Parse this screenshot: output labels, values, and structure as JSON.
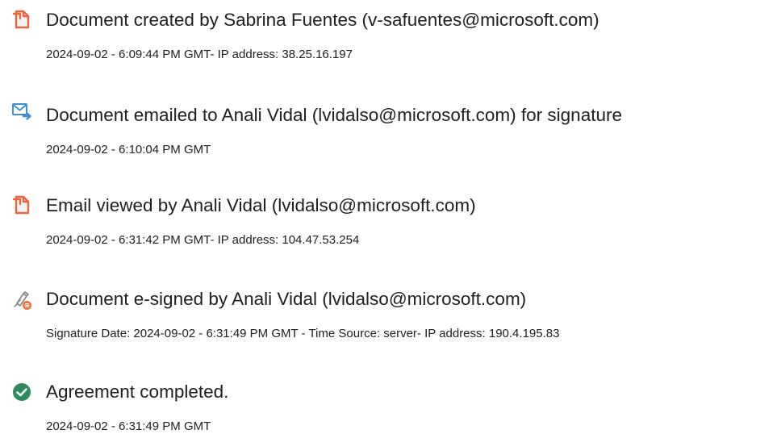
{
  "colors": {
    "document_icon": "#f0643c",
    "email_icon": "#3d8fd6",
    "esign_icon": "#8a8a8a",
    "esign_badge": "#f07138",
    "completed_icon": "#2d8a5b",
    "text": "#202020"
  },
  "events": [
    {
      "icon": "document-icon",
      "title": "Document created by Sabrina Fuentes (v-safuentes@microsoft.com)",
      "detail": "2024-09-02 - 6:09:44 PM GMT- IP address: 38.25.16.197"
    },
    {
      "icon": "email-sent-icon",
      "title": "Document emailed to Anali Vidal (lvidalso@microsoft.com) for signature",
      "detail": "2024-09-02 - 6:10:04 PM GMT"
    },
    {
      "icon": "document-icon",
      "title": "Email viewed by Anali Vidal (lvidalso@microsoft.com)",
      "detail": "2024-09-02 - 6:31:42 PM GMT- IP address: 104.47.53.254"
    },
    {
      "icon": "esign-pen-icon",
      "title": "Document e-signed by Anali Vidal (lvidalso@microsoft.com)",
      "detail": "Signature Date: 2024-09-02 - 6:31:49 PM GMT - Time Source: server- IP address: 190.4.195.83"
    },
    {
      "icon": "check-circle-icon",
      "title": "Agreement completed.",
      "detail": "2024-09-02 - 6:31:49 PM GMT"
    }
  ]
}
